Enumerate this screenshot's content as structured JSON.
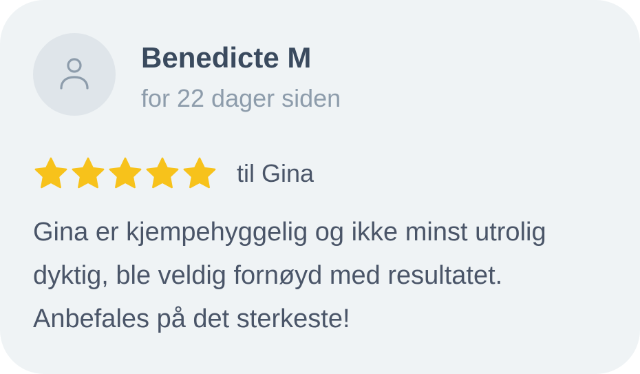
{
  "review": {
    "author": "Benedicte M",
    "time_ago": "for 22 dager siden",
    "rating": 5,
    "rating_max": 5,
    "recipient": "til Gina",
    "text": "Gina er kjempehyggelig og ikke minst utrolig dyktig, ble veldig fornøyd med resultatet. Anbefales på det sterkeste!"
  },
  "icons": {
    "avatar": "user-icon",
    "star": "star-icon"
  },
  "colors": {
    "card_background": "#eff3f5",
    "avatar_background": "#dfe5ea",
    "star": "#f7c21b",
    "name": "#3a4a5e",
    "muted": "#8d9cab",
    "body": "#4a5568"
  }
}
